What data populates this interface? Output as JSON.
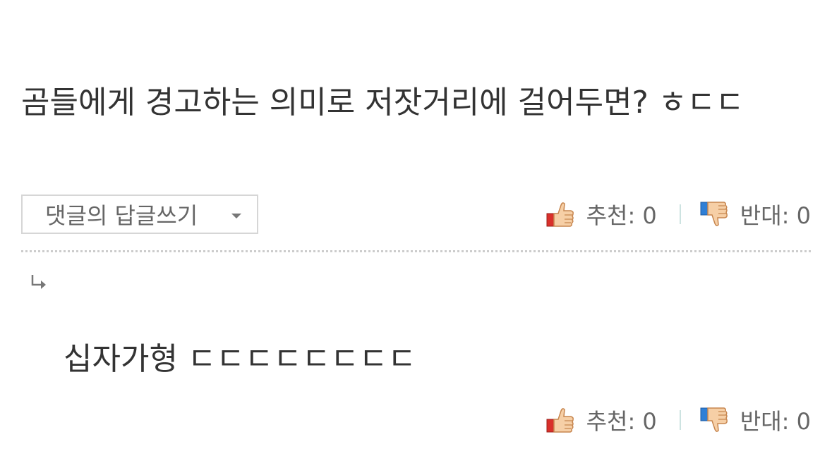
{
  "comment": {
    "text": "곰들에게 경고하는 의미로 저잣거리에 걸어두면? ㅎㄷㄷ",
    "reply_dropdown_label": "댓글의 답글쓰기",
    "likes_label": "추천: 0",
    "dislikes_label": "반대: 0"
  },
  "reply": {
    "text": "십자가형 ㄷㄷㄷㄷㄷㄷㄷㄷ",
    "likes_label": "추천: 0",
    "dislikes_label": "반대: 0"
  },
  "icons": {
    "thumbs_up": "thumbs-up-icon",
    "thumbs_down": "thumbs-down-icon",
    "reply_arrow": "reply-arrow-icon",
    "dropdown": "chevron-down-icon"
  },
  "colors": {
    "thumb_up_cuff": "#d9302b",
    "thumb_down_cuff": "#2f7fd6",
    "thumb_skin": "#f6cfa6",
    "text": "#333333",
    "muted_text": "#666666",
    "divider": "#cccccc",
    "vote_separator": "#cde3e1"
  }
}
